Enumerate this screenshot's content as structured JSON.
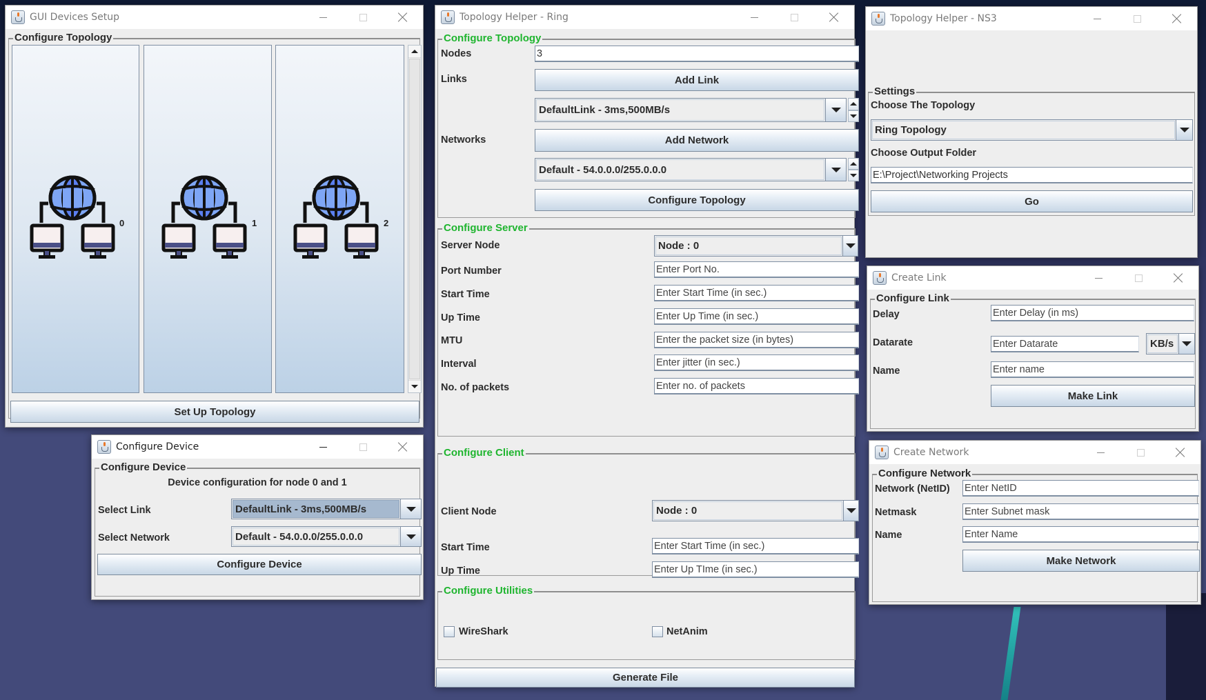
{
  "desktop": {
    "background_color": "#434a7a"
  },
  "colors": {
    "section_green": "#1fb52f",
    "window_bg": "#eeeeee",
    "button_gradient_end": "#c8d7e6"
  },
  "gui_devices": {
    "title": "GUI Devices Setup",
    "group_title": "Configure Topology",
    "nodes": [
      {
        "id": "0",
        "icon": "network-globe-computers-icon"
      },
      {
        "id": "1",
        "icon": "network-globe-computers-icon"
      },
      {
        "id": "2",
        "icon": "network-globe-computers-icon"
      }
    ],
    "setup_button": "Set Up Topology"
  },
  "configure_device": {
    "title": "Configure Device",
    "group_title": "Configure Device",
    "heading": "Device configuration for node 0 and 1",
    "select_link_label": "Select Link",
    "select_link_value": "DefaultLink - 3ms,500MB/s",
    "select_network_label": "Select Network",
    "select_network_value": "Default - 54.0.0.0/255.0.0.0",
    "configure_button": "Configure Device"
  },
  "ring": {
    "title": "Topology Helper - Ring",
    "topology": {
      "group_title": "Configure Topology",
      "nodes_label": "Nodes",
      "nodes_value": "3",
      "links_label": "Links",
      "add_link_button": "Add Link",
      "link_selected": "DefaultLink - 3ms,500MB/s",
      "networks_label": "Networks",
      "add_network_button": "Add Network",
      "network_selected": "Default - 54.0.0.0/255.0.0.0",
      "configure_button": "Configure Topology"
    },
    "server": {
      "group_title": "Configure Server",
      "server_node_label": "Server Node",
      "server_node_value": "Node : 0",
      "fields": [
        {
          "label": "Port Number",
          "placeholder": "Enter Port No."
        },
        {
          "label": "Start Time",
          "placeholder": "Enter Start Time (in sec.)"
        },
        {
          "label": "Up Time",
          "placeholder": "Enter Up Time (in sec.)"
        },
        {
          "label": "MTU",
          "placeholder": "Enter the packet size (in bytes)"
        },
        {
          "label": "Interval",
          "placeholder": "Enter jitter (in sec.)"
        },
        {
          "label": "No. of packets",
          "placeholder": "Enter no. of packets"
        }
      ]
    },
    "client": {
      "group_title": "Configure Client",
      "client_node_label": "Client Node",
      "client_node_value": "Node : 0",
      "start_time_label": "Start Time",
      "start_time_placeholder": "Enter Start Time (in sec.)",
      "up_time_label": "Up Time",
      "up_time_placeholder": "Enter Up TIme (in sec.)"
    },
    "utilities": {
      "group_title": "Configure Utilities",
      "wireshark_label": "WireShark",
      "wireshark_checked": false,
      "netanim_label": "NetAnim",
      "netanim_checked": false
    },
    "generate_button": "Generate File"
  },
  "ns3": {
    "title": "Topology Helper - NS3",
    "group_title": "Settings",
    "choose_topology_label": "Choose The Topology",
    "topology_value": "Ring Topology",
    "choose_output_label": "Choose Output Folder",
    "output_folder_value": "E:\\Project\\Networking Projects",
    "go_button": "Go"
  },
  "create_link": {
    "title": "Create Link",
    "group_title": "Configure Link",
    "delay_label": "Delay",
    "delay_placeholder": "Enter Delay (in ms)",
    "datarate_label": "Datarate",
    "datarate_placeholder": "Enter Datarate",
    "datarate_unit": "KB/s",
    "name_label": "Name",
    "name_placeholder": "Enter name",
    "make_button": "Make Link"
  },
  "create_network": {
    "title": "Create Network",
    "group_title": "Configure Network",
    "netid_label": "Network (NetID)",
    "netid_placeholder": "Enter NetID",
    "netmask_label": "Netmask",
    "netmask_placeholder": "Enter Subnet mask",
    "name_label": "Name",
    "name_placeholder": "Enter Name",
    "make_button": "Make Network"
  }
}
